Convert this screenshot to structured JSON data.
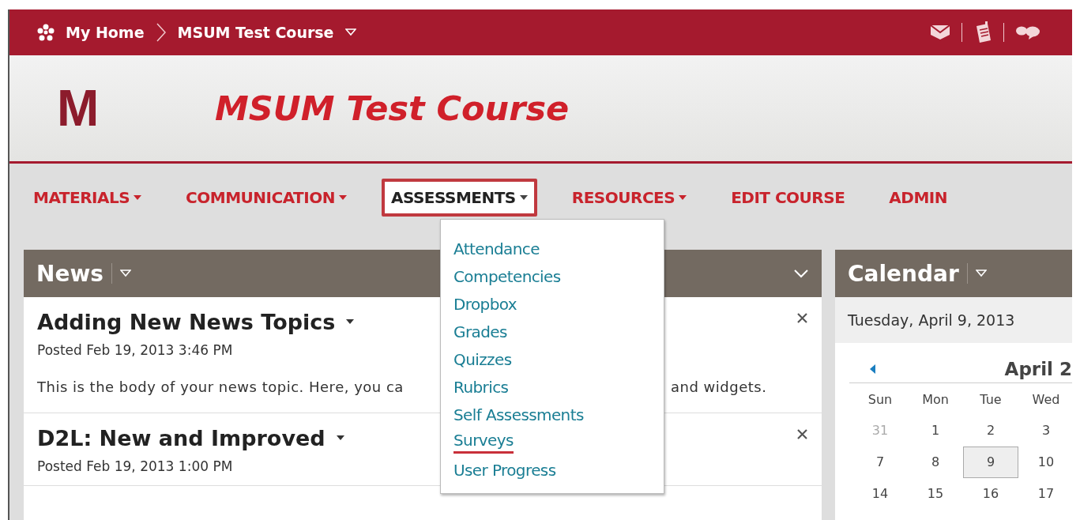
{
  "top_bar": {
    "home": "My Home",
    "course": "MSUM Test Course"
  },
  "header": {
    "logo": "M",
    "title": "MSUM Test Course"
  },
  "nav": [
    {
      "label": "MATERIALS",
      "has_menu": true,
      "selected": false
    },
    {
      "label": "COMMUNICATION",
      "has_menu": true,
      "selected": false
    },
    {
      "label": "ASSESSMENTS",
      "has_menu": true,
      "selected": true
    },
    {
      "label": "RESOURCES",
      "has_menu": true,
      "selected": false
    },
    {
      "label": "EDIT COURSE",
      "has_menu": false,
      "selected": false
    },
    {
      "label": "ADMIN",
      "has_menu": false,
      "selected": false
    }
  ],
  "assessments_menu": {
    "items": [
      {
        "label": "Attendance",
        "selected": false
      },
      {
        "label": "Competencies",
        "selected": false
      },
      {
        "label": "Dropbox",
        "selected": false
      },
      {
        "label": "Grades",
        "selected": false
      },
      {
        "label": "Quizzes",
        "selected": false
      },
      {
        "label": "Rubrics",
        "selected": false
      },
      {
        "label": "Self Assessments",
        "selected": false
      },
      {
        "label": "Surveys",
        "selected": true
      },
      {
        "label": "User Progress",
        "selected": false
      }
    ]
  },
  "news": {
    "title": "News",
    "items": [
      {
        "title": "Adding New News Topics",
        "posted": "Posted Feb 19, 2013 3:46 PM",
        "body_start": "This is the body of your news topic. Here, you ca",
        "body_end": "and widgets."
      },
      {
        "title": "D2L: New and Improved",
        "posted": "Posted Feb 19, 2013 1:00 PM"
      }
    ]
  },
  "calendar": {
    "title": "Calendar",
    "date": "Tuesday, April 9, 2013",
    "month": "April 2",
    "weekdays": [
      "Sun",
      "Mon",
      "Tue",
      "Wed"
    ],
    "weeks": [
      [
        {
          "day": "31",
          "other_month": true,
          "selected": false
        },
        {
          "day": "1",
          "other_month": false,
          "selected": false
        },
        {
          "day": "2",
          "other_month": false,
          "selected": false
        },
        {
          "day": "3",
          "other_month": false,
          "selected": false
        }
      ],
      [
        {
          "day": "7",
          "other_month": false,
          "selected": false
        },
        {
          "day": "8",
          "other_month": false,
          "selected": false
        },
        {
          "day": "9",
          "other_month": false,
          "selected": true
        },
        {
          "day": "10",
          "other_month": false,
          "selected": false
        }
      ],
      [
        {
          "day": "14",
          "other_month": false,
          "selected": false
        },
        {
          "day": "15",
          "other_month": false,
          "selected": false
        },
        {
          "day": "16",
          "other_month": false,
          "selected": false
        },
        {
          "day": "17",
          "other_month": false,
          "selected": false
        }
      ]
    ]
  }
}
